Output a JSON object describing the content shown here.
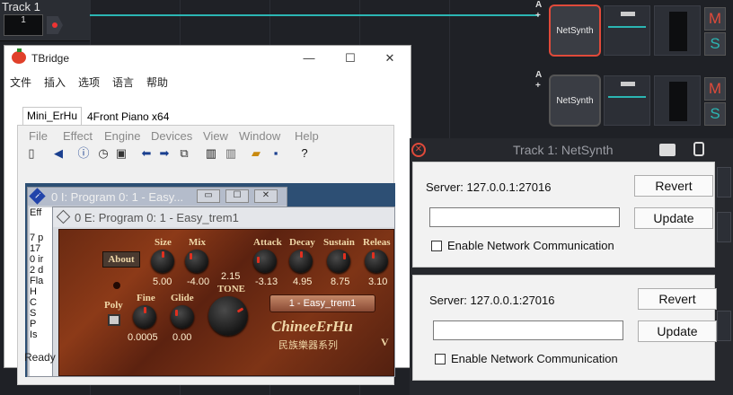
{
  "daw": {
    "track_name": "Track 1",
    "track_number": "1",
    "synth_label": "NetSynth",
    "mute_label": "M",
    "solo_label": "S",
    "automation_label": "A",
    "plus_label": "+",
    "accent": "#2bb6b3",
    "selected_border": "#e04a3a"
  },
  "tbridge": {
    "title": "TBridge",
    "window_controls": {
      "minimize": "—",
      "maximize": "☐",
      "close": "✕"
    },
    "menu": [
      "文件",
      "插入",
      "选项",
      "语言",
      "帮助"
    ],
    "tabs": [
      "Mini_ErHu",
      "4Front Piano x64"
    ],
    "submenu": [
      "File",
      "Effect",
      "Engine",
      "Devices",
      "View",
      "Window",
      "Help"
    ],
    "child1_title": "0 I:  Program 0: 1 - Easy...",
    "child1_list": [
      "Eff",
      "",
      "7 p",
      "17",
      "0 ir",
      "2 d",
      "Fla",
      " H",
      " C",
      " S",
      " P",
      " Is"
    ],
    "child2_title": "0 E:  Program 0: 1 - Easy_trem1",
    "plugin": {
      "about_label": "About",
      "poly_label": "Poly",
      "tone_label": "TONE",
      "tone_value": "2.15",
      "program_display": "1 - Easy_trem1",
      "brand": "ChineeErHu",
      "brand_sub": "民族樂器系列",
      "version_mark": "V",
      "knobs_top": [
        {
          "label": "Size",
          "value": "5.00"
        },
        {
          "label": "Mix",
          "value": "-4.00"
        },
        {
          "label": "Attack",
          "value": "-3.13"
        },
        {
          "label": "Decay",
          "value": "4.95"
        },
        {
          "label": "Sustain",
          "value": "8.75"
        },
        {
          "label": "Releas",
          "value": "3.10"
        }
      ],
      "knobs_bottom": [
        {
          "label": "Fine",
          "value": "0.0005"
        },
        {
          "label": "Glide",
          "value": "0.00"
        }
      ]
    },
    "status": "Ready"
  },
  "netsynth_panel": {
    "title": "Track 1: NetSynth",
    "cards": [
      {
        "server": "Server: 127.0.0.1:27016",
        "revert": "Revert",
        "update": "Update",
        "checkbox_label": "Enable Network Communication",
        "input_value": ""
      },
      {
        "server": "Server: 127.0.0.1:27016",
        "revert": "Revert",
        "update": "Update",
        "checkbox_label": "Enable Network Communication",
        "input_value": ""
      }
    ]
  }
}
